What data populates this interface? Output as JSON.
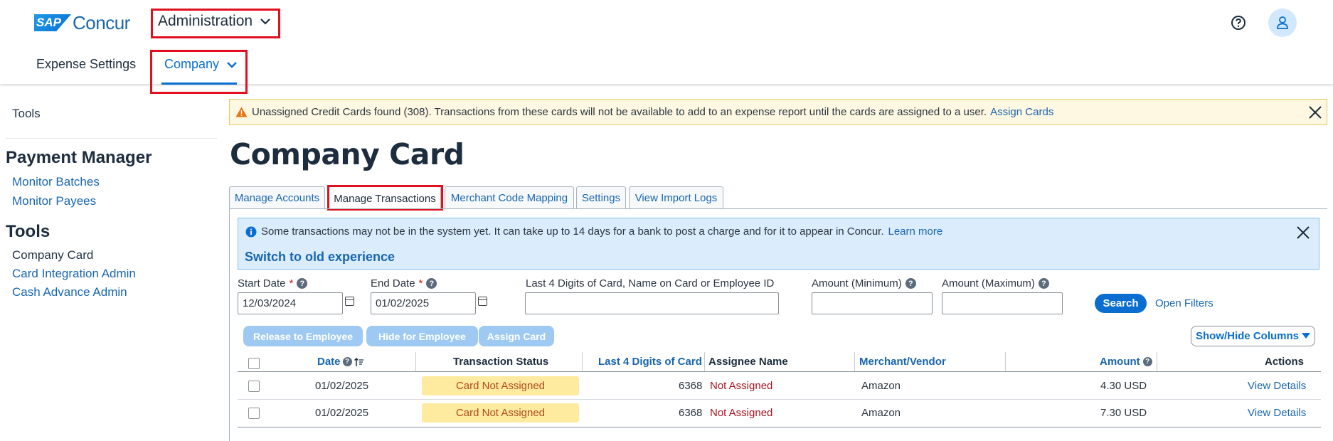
{
  "header": {
    "logo_sap": "SAP",
    "logo_concur": "Concur",
    "admin_menu": "Administration",
    "nav_expense_settings": "Expense Settings",
    "nav_company": "Company"
  },
  "sidebar": {
    "tools_top": "Tools",
    "payment_manager_heading": "Payment Manager",
    "monitor_batches": "Monitor Batches",
    "monitor_payees": "Monitor Payees",
    "tools_heading": "Tools",
    "company_card": "Company Card",
    "card_integration_admin": "Card Integration Admin",
    "cash_advance_admin": "Cash Advance Admin"
  },
  "warning_banner": {
    "message": "Unassigned Credit Cards found (308). Transactions from these cards will not be available to add to an expense report until the cards are assigned to a user.",
    "link": "Assign Cards"
  },
  "page_title": "Company Card",
  "tabs": {
    "manage_accounts": "Manage Accounts",
    "manage_transactions": "Manage Transactions",
    "merchant_code_mapping": "Merchant Code Mapping",
    "settings": "Settings",
    "view_import_logs": "View Import Logs"
  },
  "info_banner": {
    "message": "Some transactions may not be in the system yet. It can take up to 14 days for a bank to post a charge and for it to appear in Concur.",
    "link": "Learn more",
    "switch": "Switch to old experience"
  },
  "filters": {
    "start_date_label": "Start Date",
    "start_date_value": "12/03/2024",
    "end_date_label": "End Date",
    "end_date_value": "01/02/2025",
    "card_label": "Last 4 Digits of Card, Name on Card or Employee ID",
    "amount_min_label": "Amount (Minimum)",
    "amount_max_label": "Amount (Maximum)",
    "required_mark": "*",
    "search_button": "Search",
    "open_filters": "Open Filters"
  },
  "actions": {
    "release_to_employee": "Release to Employee",
    "hide_for_employee": "Hide for Employee",
    "assign_card": "Assign Card",
    "show_hide_columns": "Show/Hide Columns"
  },
  "table": {
    "headers": {
      "date": "Date",
      "status": "Transaction Status",
      "last4": "Last 4 Digits of Card",
      "assignee": "Assignee Name",
      "merchant": "Merchant/Vendor",
      "amount": "Amount",
      "actions": "Actions"
    },
    "rows": [
      {
        "date": "01/02/2025",
        "status": "Card Not Assigned",
        "last4": "6368",
        "assignee": "Not Assigned",
        "merchant": "Amazon",
        "amount": "4.30 USD",
        "action": "View Details"
      },
      {
        "date": "01/02/2025",
        "status": "Card Not Assigned",
        "last4": "6368",
        "assignee": "Not Assigned",
        "merchant": "Amazon",
        "amount": "7.30 USD",
        "action": "View Details"
      }
    ]
  },
  "colors": {
    "accent": "#0a6ed1",
    "link": "#1866b0",
    "highlight_box": "#e0101e",
    "warning_bg": "#fef7e1",
    "info_bg": "#dbecfc",
    "status_pill_bg": "#feeba0"
  },
  "icons": [
    "chevron-down-icon",
    "help-icon",
    "user-icon",
    "warning-icon",
    "close-icon",
    "info-icon",
    "calendar-icon",
    "sort-icon",
    "triangle-down-icon"
  ]
}
